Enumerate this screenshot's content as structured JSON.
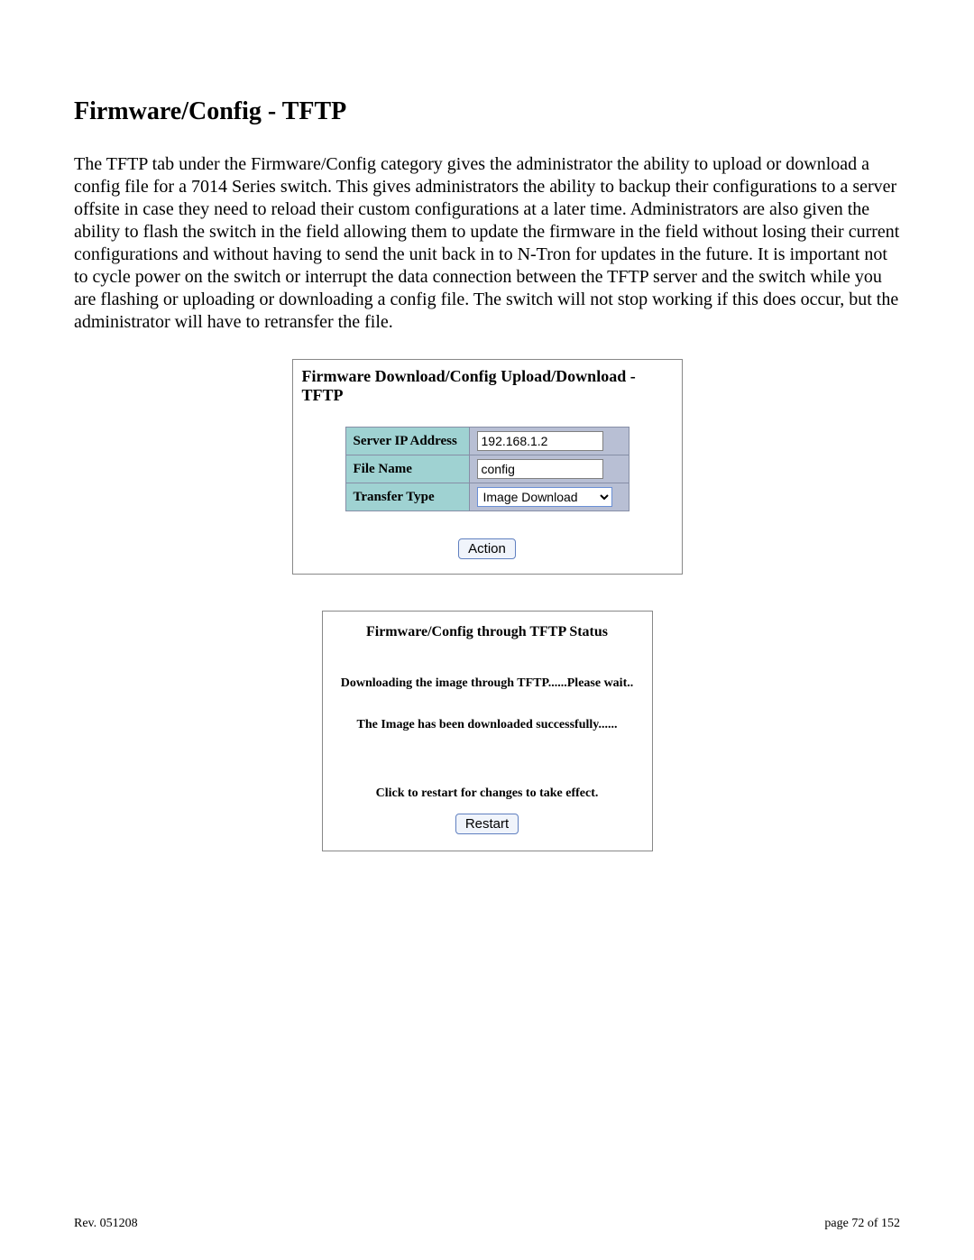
{
  "section": {
    "title": "Firmware/Config - TFTP",
    "body": "The TFTP tab under the Firmware/Config category gives the administrator the ability to upload or download a config file for a 7014 Series switch.  This gives administrators the ability to backup their configurations to a server offsite in case they need to reload their custom configurations at a later time.  Administrators are also given the ability to flash the switch in the field allowing them to update the firmware in the field without losing their current configurations and without having to send the unit back in to N-Tron for updates in the future.  It is important not to cycle power on the switch or interrupt the data connection between the TFTP server and the switch while you are flashing or uploading or downloading a config file.  The switch will not stop working if this does occur, but the administrator will have to retransfer the file."
  },
  "tftp_panel": {
    "title": "Firmware Download/Config Upload/Download - TFTP",
    "fields": {
      "server_ip_label": "Server IP Address",
      "server_ip_value": "192.168.1.2",
      "file_name_label": "File Name",
      "file_name_value": "config",
      "transfer_type_label": "Transfer Type",
      "transfer_type_value": "Image Download"
    },
    "action_label": "Action"
  },
  "status_panel": {
    "title": "Firmware/Config through TFTP Status",
    "downloading_msg": "Downloading the image through TFTP......Please wait..",
    "success_msg": "The Image has been downloaded successfully......",
    "restart_prompt": "Click to restart for changes to take effect.",
    "restart_label": "Restart"
  },
  "footer": {
    "rev": "Rev.  051208",
    "page": "page 72 of 152"
  }
}
